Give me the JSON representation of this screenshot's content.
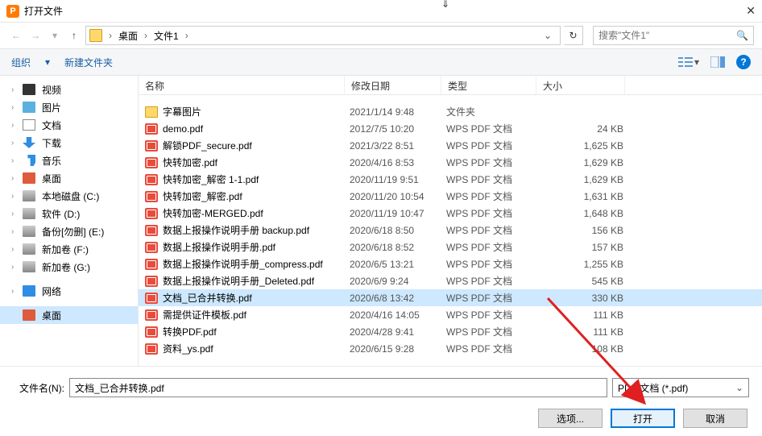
{
  "title": "打开文件",
  "breadcrumb": {
    "parts": [
      "桌面",
      "文件1"
    ]
  },
  "search": {
    "placeholder": "搜索\"文件1\""
  },
  "toolbar": {
    "organize": "组织",
    "newfolder": "新建文件夹"
  },
  "sidebar": {
    "items": [
      {
        "label": "视频",
        "icon": "ic-video"
      },
      {
        "label": "图片",
        "icon": "ic-pic"
      },
      {
        "label": "文档",
        "icon": "ic-doc"
      },
      {
        "label": "下载",
        "icon": "ic-dl"
      },
      {
        "label": "音乐",
        "icon": "ic-music"
      },
      {
        "label": "桌面",
        "icon": "ic-desk"
      },
      {
        "label": "本地磁盘 (C:)",
        "icon": "ic-disk"
      },
      {
        "label": "软件 (D:)",
        "icon": "ic-disk"
      },
      {
        "label": "备份[勿删] (E:)",
        "icon": "ic-disk"
      },
      {
        "label": "新加卷 (F:)",
        "icon": "ic-disk"
      },
      {
        "label": "新加卷 (G:)",
        "icon": "ic-disk"
      }
    ],
    "network": "网络",
    "desktop": "桌面"
  },
  "columns": {
    "name": "名称",
    "date": "修改日期",
    "type": "类型",
    "size": "大小"
  },
  "files": [
    {
      "name": "字幕图片",
      "date": "2021/1/14 9:48",
      "type": "文件夹",
      "size": "",
      "icon": "fic-folder"
    },
    {
      "name": "demo.pdf",
      "date": "2012/7/5 10:20",
      "type": "WPS PDF 文档",
      "size": "24 KB",
      "icon": "fic-pdf"
    },
    {
      "name": "解锁PDF_secure.pdf",
      "date": "2021/3/22 8:51",
      "type": "WPS PDF 文档",
      "size": "1,625 KB",
      "icon": "fic-pdf"
    },
    {
      "name": "快转加密.pdf",
      "date": "2020/4/16 8:53",
      "type": "WPS PDF 文档",
      "size": "1,629 KB",
      "icon": "fic-pdf"
    },
    {
      "name": "快转加密_解密 1-1.pdf",
      "date": "2020/11/19 9:51",
      "type": "WPS PDF 文档",
      "size": "1,629 KB",
      "icon": "fic-pdf"
    },
    {
      "name": "快转加密_解密.pdf",
      "date": "2020/11/20 10:54",
      "type": "WPS PDF 文档",
      "size": "1,631 KB",
      "icon": "fic-pdf"
    },
    {
      "name": "快转加密-MERGED.pdf",
      "date": "2020/11/19 10:47",
      "type": "WPS PDF 文档",
      "size": "1,648 KB",
      "icon": "fic-pdf"
    },
    {
      "name": "数据上报操作说明手册 backup.pdf",
      "date": "2020/6/18 8:50",
      "type": "WPS PDF 文档",
      "size": "156 KB",
      "icon": "fic-pdf"
    },
    {
      "name": "数据上报操作说明手册.pdf",
      "date": "2020/6/18 8:52",
      "type": "WPS PDF 文档",
      "size": "157 KB",
      "icon": "fic-pdf"
    },
    {
      "name": "数据上报操作说明手册_compress.pdf",
      "date": "2020/6/5 13:21",
      "type": "WPS PDF 文档",
      "size": "1,255 KB",
      "icon": "fic-pdf"
    },
    {
      "name": "数据上报操作说明手册_Deleted.pdf",
      "date": "2020/6/9 9:24",
      "type": "WPS PDF 文档",
      "size": "545 KB",
      "icon": "fic-pdf"
    },
    {
      "name": "文档_已合并转换.pdf",
      "date": "2020/6/8 13:42",
      "type": "WPS PDF 文档",
      "size": "330 KB",
      "icon": "fic-pdf",
      "selected": true
    },
    {
      "name": "需提供证件模板.pdf",
      "date": "2020/4/16 14:05",
      "type": "WPS PDF 文档",
      "size": "111 KB",
      "icon": "fic-pdf"
    },
    {
      "name": "转换PDF.pdf",
      "date": "2020/4/28 9:41",
      "type": "WPS PDF 文档",
      "size": "111 KB",
      "icon": "fic-pdf"
    },
    {
      "name": "资料_ys.pdf",
      "date": "2020/6/15 9:28",
      "type": "WPS PDF 文档",
      "size": "108 KB",
      "icon": "fic-pdf"
    }
  ],
  "filename": {
    "label": "文件名(N):",
    "value": "文档_已合并转换.pdf"
  },
  "filter": "PDF 文档 (*.pdf)",
  "buttons": {
    "options": "选项...",
    "open": "打开",
    "cancel": "取消"
  }
}
